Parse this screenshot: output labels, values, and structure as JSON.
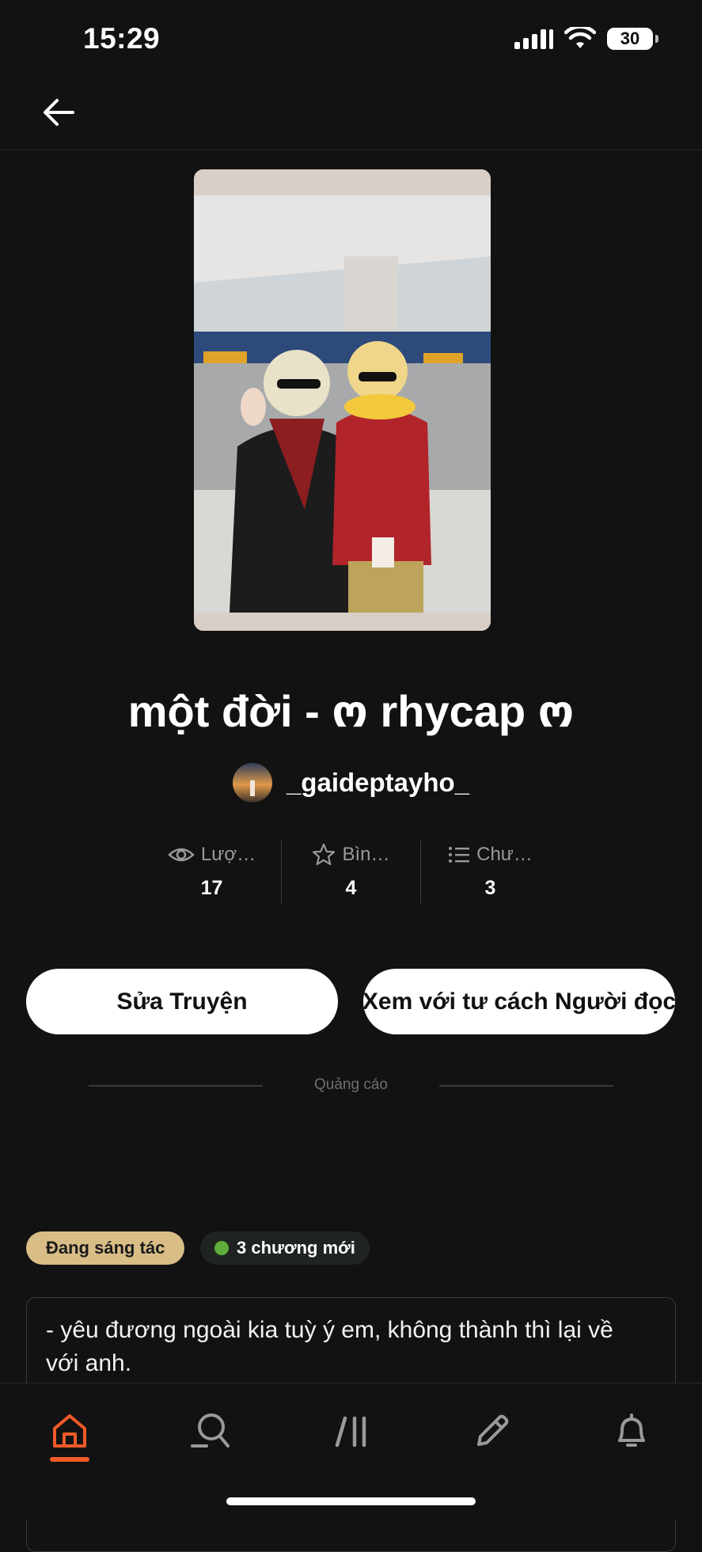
{
  "status_bar": {
    "time": "15:29",
    "battery": "30"
  },
  "story": {
    "title": "một đời - ო rhycap ო",
    "author": "_gaideptayho_"
  },
  "stats": [
    {
      "icon": "eye-icon",
      "label": "Lượ…",
      "value": "17"
    },
    {
      "icon": "star-icon",
      "label": "Bìn…",
      "value": "4"
    },
    {
      "icon": "list-icon",
      "label": "Chư…",
      "value": "3"
    }
  ],
  "buttons": {
    "edit": "Sửa Truyện",
    "read_as_reader": "Xem với tư cách Người đọc"
  },
  "ad_label": "Quảng cáo",
  "tags": {
    "status": "Đang sáng tác",
    "new_chapters": "3 chương mới"
  },
  "description": "- yêu đương ngoài kia tuỳ ý em, không thành thì lại về với anh.",
  "bottom_nav": {
    "items": [
      "home-icon",
      "search-icon",
      "library-icon",
      "write-icon",
      "notifications-icon"
    ],
    "active": "home-icon",
    "accent": "#f05a28"
  },
  "colors": {
    "background": "#121212",
    "status_tag": "#d8bd86",
    "new_dot": "#5fae3c"
  }
}
